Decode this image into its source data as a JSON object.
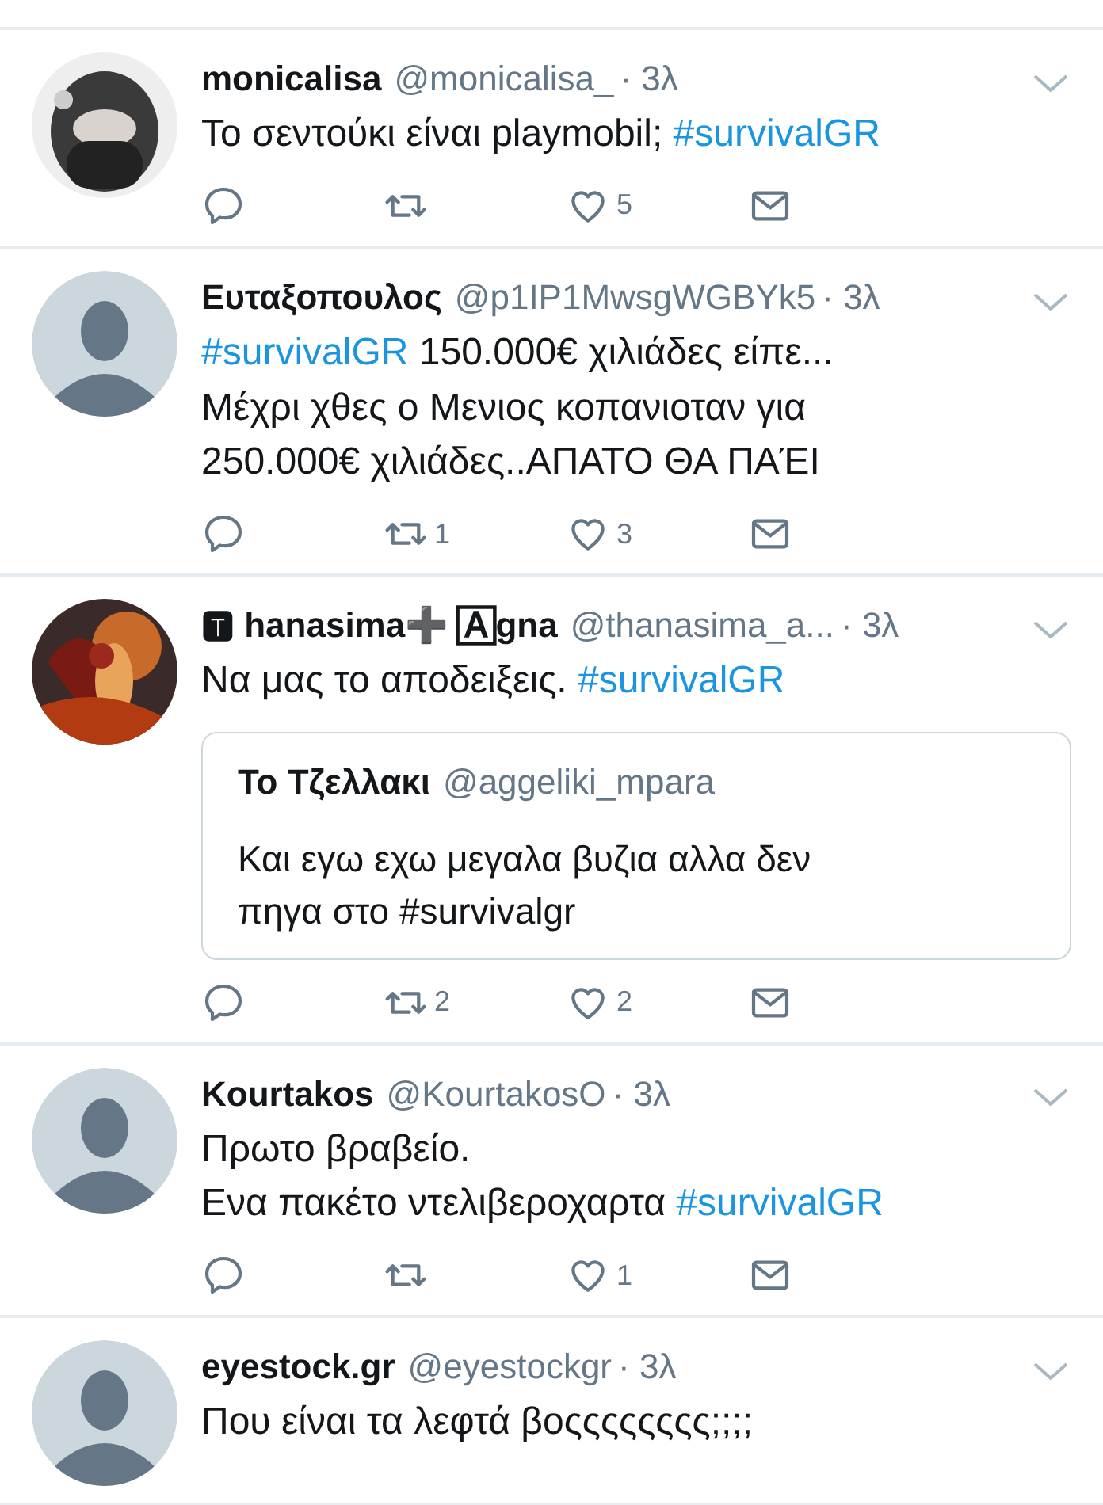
{
  "tweets": [
    {
      "name": "monicalisa",
      "handle": "@monicalisa_",
      "time": "· 3λ",
      "text": [
        {
          "kind": "text",
          "text": "Το σεντούκι είναι playmobil; "
        },
        {
          "kind": "hashtag",
          "text": "#survivalGR"
        }
      ],
      "likes": "5"
    },
    {
      "name": "Ευταξοπουλος",
      "handle": "@p1IP1MwsgWGBYk5",
      "time": "· 3λ",
      "avatar": {
        "kind": "default"
      },
      "text": [
        {
          "kind": "hashtag",
          "text": "#survivalGR"
        },
        {
          "kind": "text",
          "text": " 150.000€ χιλιάδες είπε...\nΜέχρι χθες ο Μενιος κοπανιοταν για\n250.000€ χιλιάδες..ΑΠΑΤΟ ΘΑ ΠΑΈΙ"
        }
      ],
      "retweets": "1",
      "likes": "3"
    },
    {
      "name": "🆃 hanasima➕ 🄰gna",
      "handle": "@thanasima_a...",
      "time": "· 3λ",
      "text": [
        {
          "kind": "text",
          "text": "Να μας το αποδειξεις. "
        },
        {
          "kind": "hashtag",
          "text": "#survivalGR"
        }
      ],
      "quote": {
        "name": "Το Τζελλακι",
        "handle": "@aggeliki_mpara",
        "text": "Και εγω εχω μεγαλα βυζια αλλα δεν\nπηγα στο #survivalgr"
      },
      "retweets": "2",
      "likes": "2"
    },
    {
      "name": "Kourtakos",
      "handle": "@KourtakosO",
      "time": "· 3λ",
      "avatar": {
        "kind": "default"
      },
      "text": [
        {
          "kind": "text",
          "text": "Πρωτο βραβείο.\nΕνα πακέτο ντελιβεροχαρτα "
        },
        {
          "kind": "hashtag",
          "text": "#survivalGR"
        }
      ],
      "likes": "1"
    },
    {
      "name": "eyestock.gr",
      "handle": "@eyestockgr",
      "time": "· 3λ",
      "avatar": {
        "kind": "default"
      },
      "text": [
        {
          "kind": "text",
          "text": "Που είναι τα λεφτά βοςςςςςςςς;;;;"
        }
      ]
    }
  ]
}
